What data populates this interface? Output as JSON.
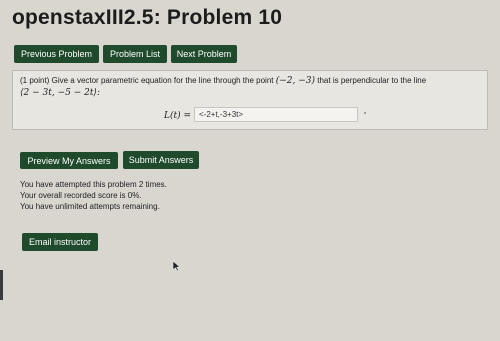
{
  "page": {
    "title": "openstaxIII2.5: Problem 10"
  },
  "nav": {
    "previous_label": "Previous Problem",
    "list_label": "Problem List",
    "next_label": "Next Problem"
  },
  "problem": {
    "points": "(1 point)",
    "text_before_point": "Give a vector parametric equation for the line through the point",
    "point": "(−2, −3)",
    "text_after_point": "that is perpendicular to the line",
    "line_vector": "⟨2 − 3t, −5 − 2t⟩:",
    "answer_label": "L(t) =",
    "answer_value": "<-2+t,-3+3t>"
  },
  "actions": {
    "preview_label": "Preview My Answers",
    "submit_label": "Submit Answers"
  },
  "status": {
    "attempts": "You have attempted this problem 2 times.",
    "score": "Your overall recorded score is 0%.",
    "remaining": "You have unlimited attempts remaining."
  },
  "footer": {
    "email_label": "Email instructor"
  },
  "colors": {
    "button_bg": "#1f4a2c",
    "button_text": "#ffffff",
    "page_bg": "#d9d6d0",
    "panel_bg": "#e8e6e1"
  },
  "icons": {
    "cursor": "mouse-cursor-icon"
  }
}
